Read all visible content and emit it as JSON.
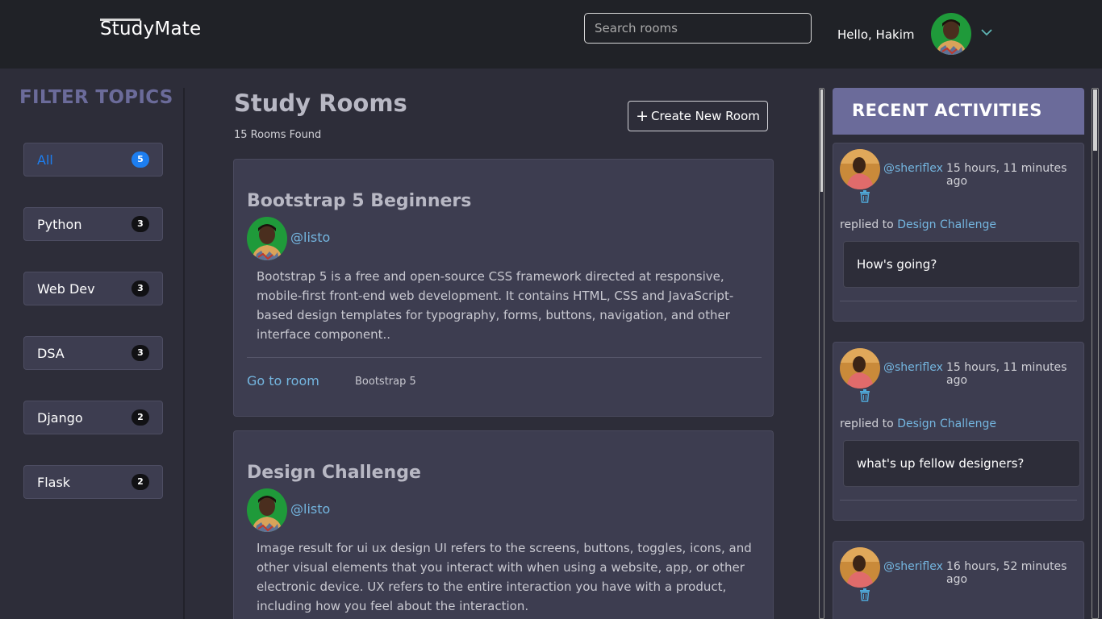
{
  "header": {
    "logo": "StudyMate",
    "search_placeholder": "Search rooms",
    "greeting": "Hello, Hakim",
    "avatar_icon": "user-avatar",
    "dropdown_icon": "chevron-down-icon",
    "bg_color": "#202227"
  },
  "sidebar": {
    "title": "FILTER TOPICS",
    "topics": [
      {
        "label": "All",
        "count": "5",
        "active": true
      },
      {
        "label": "Python",
        "count": "3"
      },
      {
        "label": "Web Dev",
        "count": "3"
      },
      {
        "label": "DSA",
        "count": "3"
      },
      {
        "label": "Django",
        "count": "2"
      },
      {
        "label": "Flask",
        "count": "2"
      }
    ]
  },
  "main": {
    "title": "Study Rooms",
    "rooms_found": "15 Rooms Found",
    "create_button": "Create New Room",
    "rooms": [
      {
        "title": "Bootstrap 5 Beginners",
        "host": "@listo",
        "description": "Bootstrap 5 is a free and open-source CSS framework directed at responsive, mobile-first front-end web development. It contains HTML, CSS and JavaScript-based design templates for typography, forms, buttons, navigation, and other interface component..",
        "link": "Go to room",
        "topic": "Bootstrap 5"
      },
      {
        "title": "Design Challenge",
        "host": "@listo",
        "description": "Image result for ui ux design UI refers to the screens, buttons, toggles, icons, and other visual elements that you interact with when using a website, app, or other electronic device. UX refers to the entire interaction you have with a product, including how you feel about the interaction."
      }
    ]
  },
  "activities": {
    "title": "RECENT ACTIVITIES",
    "items": [
      {
        "user": "@sheriflex",
        "time": "15 hours, 11 minutes ago",
        "action": "replied to",
        "room": "Design Challenge",
        "message": "How's going?"
      },
      {
        "user": "@sheriflex",
        "time": "15 hours, 11 minutes ago",
        "action": "replied to",
        "room": "Design Challenge",
        "message": "what's up fellow designers?"
      },
      {
        "user": "@sheriflex",
        "time": "16 hours, 52 minutes ago"
      }
    ]
  },
  "colors": {
    "background": "#2d2d39",
    "card": "#3d3d50",
    "accent": "#6b6b9a",
    "link": "#74b6e0",
    "active": "#1d7ef0"
  }
}
